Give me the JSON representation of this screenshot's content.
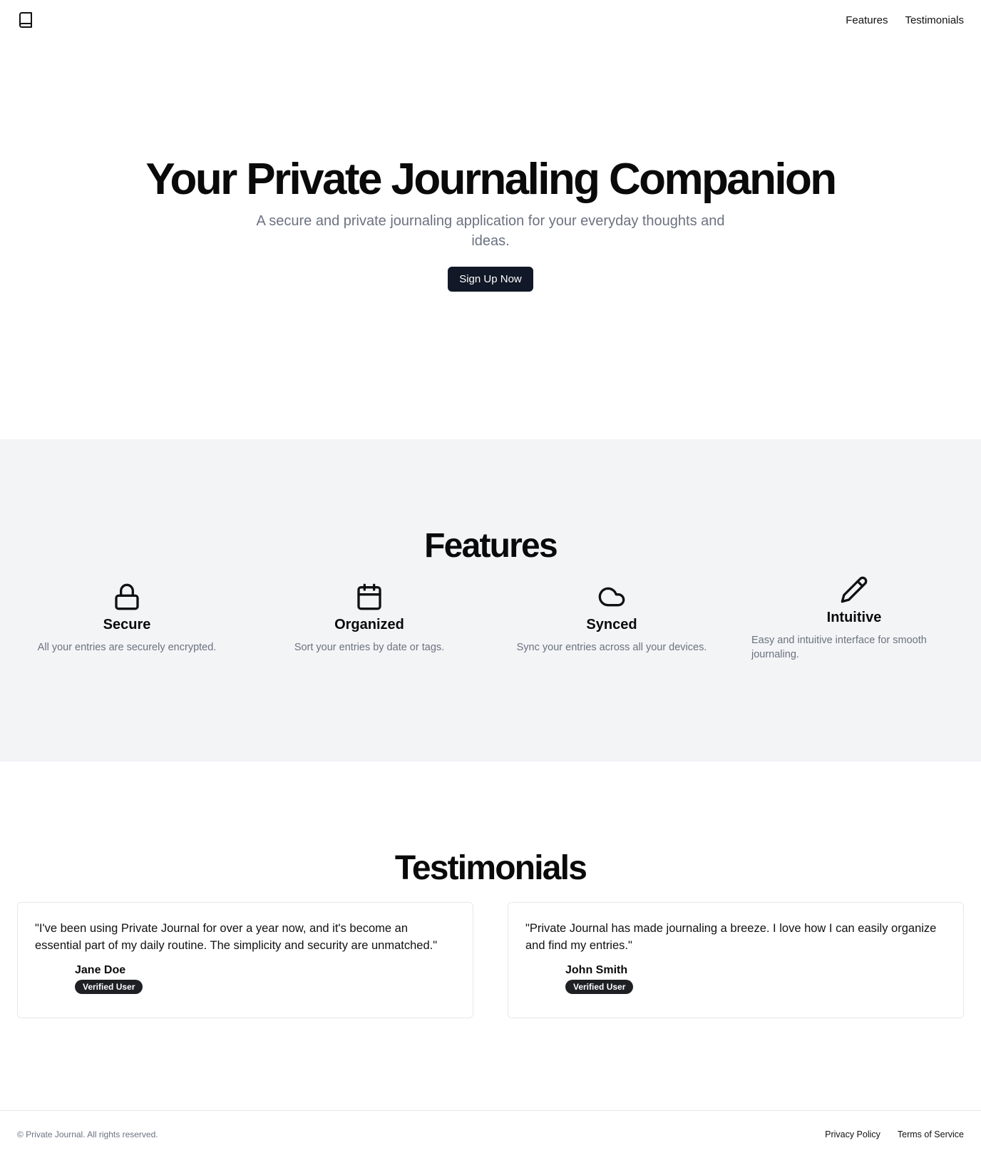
{
  "header": {
    "logo_icon": "book-icon",
    "nav": [
      {
        "label": "Features"
      },
      {
        "label": "Testimonials"
      }
    ]
  },
  "hero": {
    "title": "Your Private Journaling Companion",
    "subtitle": "A secure and private journaling application for your everyday thoughts and ideas.",
    "cta_label": "Sign Up Now"
  },
  "features": {
    "title": "Features",
    "items": [
      {
        "icon": "lock-icon",
        "title": "Secure",
        "description": "All your entries are securely encrypted."
      },
      {
        "icon": "calendar-icon",
        "title": "Organized",
        "description": "Sort your entries by date or tags."
      },
      {
        "icon": "cloud-icon",
        "title": "Synced",
        "description": "Sync your entries across all your devices."
      },
      {
        "icon": "pencil-icon",
        "title": "Intuitive",
        "description": "Easy and intuitive interface for smooth journaling."
      }
    ]
  },
  "testimonials": {
    "title": "Testimonials",
    "items": [
      {
        "quote": "\"I've been using Private Journal for over a year now, and it's become an essential part of my daily routine. The simplicity and security are unmatched.\"",
        "name": "Jane Doe",
        "badge": "Verified User"
      },
      {
        "quote": "\"Private Journal has made journaling a breeze. I love how I can easily organize and find my entries.\"",
        "name": "John Smith",
        "badge": "Verified User"
      }
    ]
  },
  "footer": {
    "copyright": "© Private Journal. All rights reserved.",
    "links": [
      {
        "label": "Privacy Policy"
      },
      {
        "label": "Terms of Service"
      }
    ]
  },
  "colors": {
    "primary_button": "#111827",
    "muted_text": "#6b7280",
    "features_bg": "#f3f4f6",
    "badge_bg": "#1f2023"
  }
}
